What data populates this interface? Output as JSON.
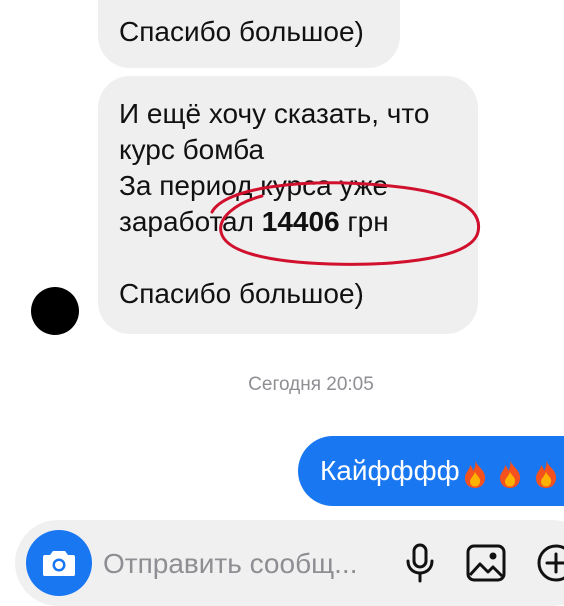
{
  "messages": {
    "previous": {
      "text": "Спасибо большое)"
    },
    "incoming": {
      "line1": "И ещё хочу сказать, что",
      "line2": "курс бомба",
      "line3": "За период курса уже",
      "line4_prefix": "заработал ",
      "amount": "14406",
      "line4_suffix": " грн",
      "line6": "Спасибо большое)"
    },
    "timestamp": "Сегодня 20:05",
    "outgoing": {
      "text": "Кайфффф",
      "emoji_icons": [
        "fire-icon",
        "fire-icon",
        "fire-icon"
      ]
    }
  },
  "composer": {
    "placeholder": "Отправить сообщ...",
    "icons": [
      "camera-icon",
      "microphone-icon",
      "gallery-icon",
      "add-icon"
    ]
  },
  "colors": {
    "incoming_bubble": "#efefef",
    "outgoing_bubble": "#1977f2",
    "accent": "#1977f2",
    "highlight": "#d0102c",
    "timestamp": "#8e8e93",
    "composer_bg": "#f0f0f0"
  }
}
